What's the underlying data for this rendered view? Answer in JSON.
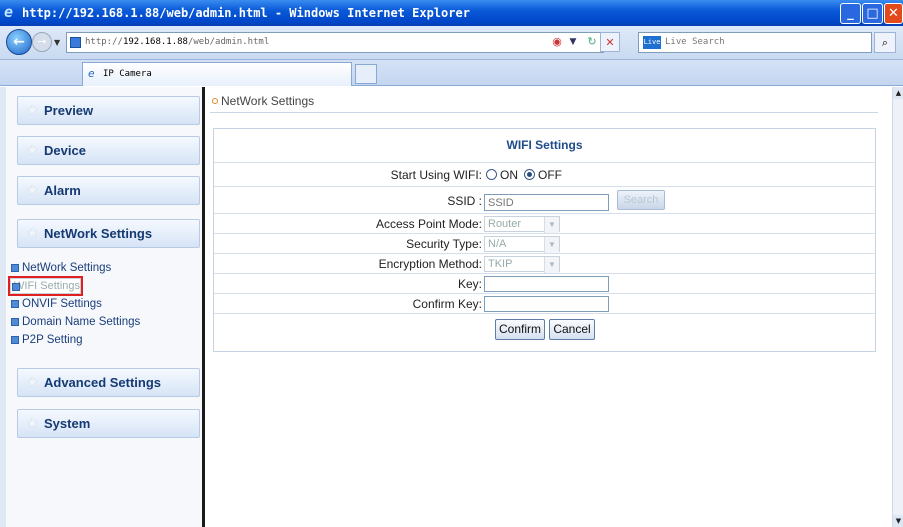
{
  "browser": {
    "title": "http://192.168.1.88/web/admin.html - Windows Internet Explorer",
    "url_prefix": "http://",
    "url_host": "192.168.1.88",
    "url_path": "/web/admin.html",
    "search_placeholder": "Live Search",
    "search_logo": "Live",
    "tab_label": "IP Camera"
  },
  "sidebar": {
    "menus": {
      "preview": "Preview",
      "device": "Device",
      "alarm": "Alarm",
      "network": "NetWork Settings",
      "advanced": "Advanced Settings",
      "system": "System"
    },
    "subitems": [
      {
        "label": "NetWork Settings"
      },
      {
        "label": "WIFI Settings",
        "selected": true
      },
      {
        "label": "ONVIF Settings"
      },
      {
        "label": "Domain Name Settings"
      },
      {
        "label": "P2P Setting"
      }
    ]
  },
  "content": {
    "breadcrumb": "NetWork Settings",
    "form_title": "WIFI Settings",
    "fields": {
      "start_using": {
        "label": "Start Using WIFI:",
        "on": "ON",
        "off": "OFF",
        "selected": "OFF"
      },
      "ssid": {
        "label": "SSID :",
        "placeholder": "SSID",
        "search_button": "Search"
      },
      "access_point_mode": {
        "label": "Access Point Mode:",
        "value": "Router"
      },
      "security_type": {
        "label": "Security Type:",
        "value": "N/A"
      },
      "encryption_method": {
        "label": "Encryption Method:",
        "value": "TKIP"
      },
      "key": {
        "label": "Key:",
        "value": ""
      },
      "confirm_key": {
        "label": "Confirm Key:",
        "value": ""
      }
    },
    "buttons": {
      "confirm": "Confirm",
      "cancel": "Cancel"
    }
  },
  "colors": {
    "selection_outline": "#e02020",
    "menu_text": "#153a72",
    "form_title": "#1e4d8a"
  }
}
